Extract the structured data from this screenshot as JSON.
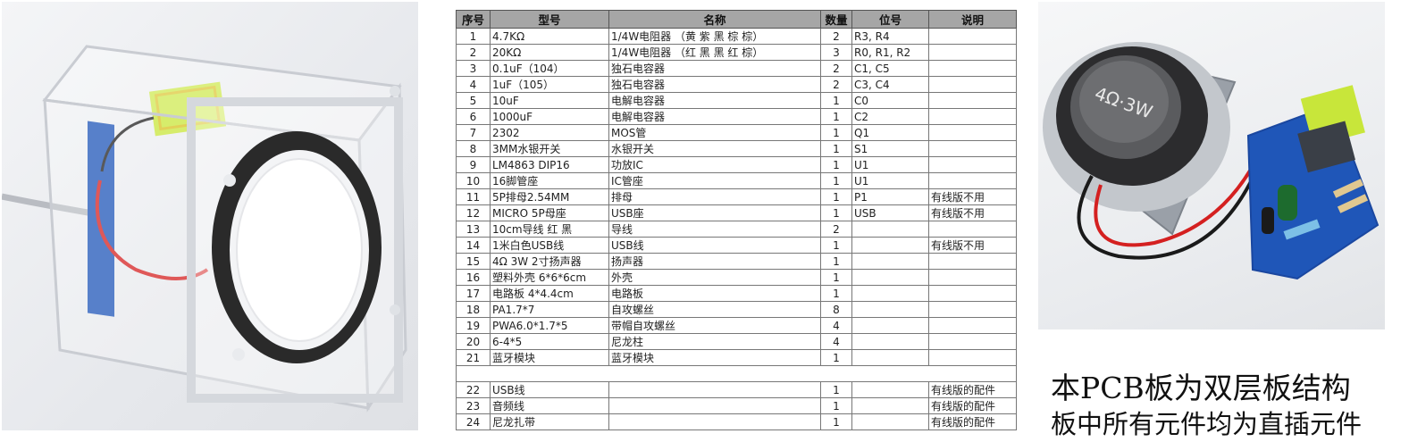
{
  "table": {
    "headers": [
      "序号",
      "型号",
      "名称",
      "数量",
      "位号",
      "说明"
    ],
    "rows": [
      [
        "1",
        "4.7KΩ",
        "1/4W电阻器 （黄 紫 黑 棕 棕）",
        "2",
        "R3, R4",
        ""
      ],
      [
        "2",
        "20KΩ",
        "1/4W电阻器 （红 黑 黑 红 棕）",
        "3",
        "R0, R1, R2",
        ""
      ],
      [
        "3",
        "0.1uF（104）",
        "独石电容器",
        "2",
        "C1, C5",
        ""
      ],
      [
        "4",
        "1uF（105）",
        "独石电容器",
        "2",
        "C3, C4",
        ""
      ],
      [
        "5",
        "10uF",
        "电解电容器",
        "1",
        "C0",
        ""
      ],
      [
        "6",
        "1000uF",
        "电解电容器",
        "1",
        "C2",
        ""
      ],
      [
        "7",
        "2302",
        "MOS管",
        "1",
        "Q1",
        ""
      ],
      [
        "8",
        "3MM水银开关",
        "水银开关",
        "1",
        "S1",
        ""
      ],
      [
        "9",
        "LM4863 DIP16",
        "功放IC",
        "1",
        "U1",
        ""
      ],
      [
        "10",
        "16脚管座",
        "IC管座",
        "1",
        "U1",
        ""
      ],
      [
        "11",
        "5P排母2.54MM",
        "排母",
        "1",
        "P1",
        "有线版不用"
      ],
      [
        "12",
        "MICRO 5P母座",
        "USB座",
        "1",
        "USB",
        "有线版不用"
      ],
      [
        "13",
        "10cm导线 红 黑",
        "导线",
        "2",
        "",
        ""
      ],
      [
        "14",
        "1米白色USB线",
        "USB线",
        "1",
        "",
        "有线版不用"
      ],
      [
        "15",
        "4Ω 3W 2寸扬声器",
        "扬声器",
        "1",
        "",
        ""
      ],
      [
        "16",
        "塑料外壳 6*6*6cm",
        "外壳",
        "1",
        "",
        ""
      ],
      [
        "17",
        "电路板 4*4.4cm",
        "电路板",
        "1",
        "",
        ""
      ],
      [
        "18",
        "PA1.7*7",
        "自攻螺丝",
        "8",
        "",
        ""
      ],
      [
        "19",
        "PWA6.0*1.7*5",
        "带帽自攻螺丝",
        "4",
        "",
        ""
      ],
      [
        "20",
        "6-4*5",
        "尼龙柱",
        "4",
        "",
        ""
      ],
      [
        "21",
        "蓝牙模块",
        "蓝牙模块",
        "1",
        "",
        ""
      ]
    ],
    "extra_rows": [
      [
        "22",
        "USB线",
        "",
        "1",
        "",
        "有线版的配件"
      ],
      [
        "23",
        "音频线",
        "",
        "1",
        "",
        "有线版的配件"
      ],
      [
        "24",
        "尼龙扎带",
        "",
        "1",
        "",
        "有线版的配件"
      ]
    ]
  },
  "speaker_label": "4Ω·3W",
  "caption": {
    "line1": "本PCB板为双层板结构",
    "line2": "板中所有元件均为直插元件"
  },
  "colors": {
    "header_bg": "#a6a6a6",
    "pcb_blue": "#1f56b8",
    "bt_module_green": "#c8e63a",
    "wire_red": "#d42020"
  }
}
